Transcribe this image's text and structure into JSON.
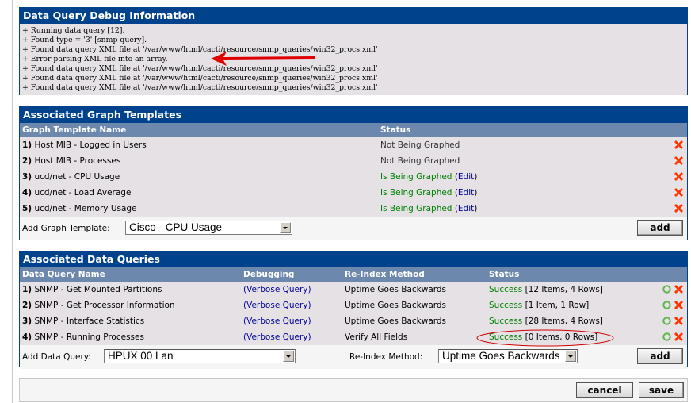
{
  "debug_panel": {
    "title": "Data Query Debug Information",
    "lines": [
      "+ Running data query [12].",
      "+ Found type = '3' [snmp query].",
      "+ Found data query XML file at '/var/www/html/cacti/resource/snmp_queries/win32_procs.xml'",
      "+ Error parsing XML file into an array.",
      "+ Found data query XML file at '/var/www/html/cacti/resource/snmp_queries/win32_procs.xml'",
      "+ Found data query XML file at '/var/www/html/cacti/resource/snmp_queries/win32_procs.xml'",
      "+ Found data query XML file at '/var/www/html/cacti/resource/snmp_queries/win32_procs.xml'"
    ],
    "annotation": "red-arrow pointing at error line"
  },
  "graph_templates": {
    "title": "Associated Graph Templates",
    "columns": [
      "Graph Template Name",
      "Status"
    ],
    "rows": [
      {
        "num": "1)",
        "name": "Host MIB - Logged in Users",
        "status": "Not Being Graphed",
        "edit": ""
      },
      {
        "num": "2)",
        "name": "Host MIB - Processes",
        "status": "Not Being Graphed",
        "edit": ""
      },
      {
        "num": "3)",
        "name": "ucd/net - CPU Usage",
        "status": "Is Being Graphed",
        "edit": "Edit"
      },
      {
        "num": "4)",
        "name": "ucd/net - Load Average",
        "status": "Is Being Graphed",
        "edit": "Edit"
      },
      {
        "num": "5)",
        "name": "ucd/net - Memory Usage",
        "status": "Is Being Graphed",
        "edit": "Edit"
      }
    ],
    "add_label": "Add Graph Template:",
    "add_selected": "Cisco - CPU Usage",
    "add_button": "add"
  },
  "data_queries": {
    "title": "Associated Data Queries",
    "columns": [
      "Data Query Name",
      "Debugging",
      "Re-Index Method",
      "Status"
    ],
    "rows": [
      {
        "num": "1)",
        "name": "SNMP - Get Mounted Partitions",
        "debug": "Verbose Query",
        "reindex": "Uptime Goes Backwards",
        "status": "Success",
        "detail": "[12 Items, 4 Rows]"
      },
      {
        "num": "2)",
        "name": "SNMP - Get Processor Information",
        "debug": "Verbose Query",
        "reindex": "Uptime Goes Backwards",
        "status": "Success",
        "detail": "[1 Item, 1 Row]"
      },
      {
        "num": "3)",
        "name": "SNMP - Interface Statistics",
        "debug": "Verbose Query",
        "reindex": "Uptime Goes Backwards",
        "status": "Success",
        "detail": "[28 Items, 4 Rows]"
      },
      {
        "num": "4)",
        "name": "SNMP - Running Processes",
        "debug": "Verbose Query",
        "reindex": "Verify All Fields",
        "status": "Success",
        "detail": "[0 Items, 0 Rows]"
      }
    ],
    "add_label": "Add Data Query:",
    "add_selected": "HPUX 00 Lan",
    "reindex_label": "Re-Index Method:",
    "reindex_selected": "Uptime Goes Backwards",
    "add_button": "add"
  },
  "footer": {
    "cancel": "cancel",
    "save": "save"
  },
  "colors": {
    "header": "#00438C",
    "colhead": "#6D88AD",
    "success": "#008000",
    "link": "#000099",
    "delete": "#FF3300",
    "annotation": "#E00000"
  }
}
